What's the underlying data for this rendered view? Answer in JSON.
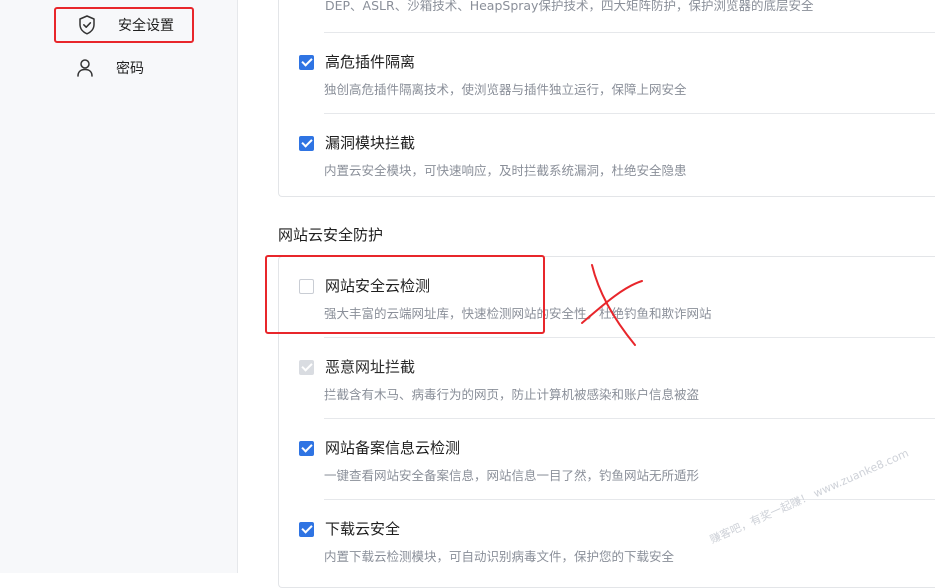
{
  "sidebar": {
    "items": [
      {
        "label": "安全设置",
        "icon": "shield-check-icon",
        "active": true
      },
      {
        "label": "密码",
        "icon": "user-icon",
        "active": false
      }
    ]
  },
  "main": {
    "top_truncated_desc": "DEP、ASLR、沙箱技术、HeapSpray保护技术，四大矩阵防护，保护浏览器的底层安全",
    "group1": [
      {
        "title": "高危插件隔离",
        "desc": "独创高危插件隔离技术，使浏览器与插件独立运行，保障上网安全",
        "checked": true
      },
      {
        "title": "漏洞模块拦截",
        "desc": "内置云安全模块，可快速响应，及时拦截系统漏洞，杜绝安全隐患",
        "checked": true
      }
    ],
    "section2_title": "网站云安全防护",
    "group2": [
      {
        "title": "网站安全云检测",
        "desc": "强大丰富的云端网址库，快速检测网站的安全性，杜绝钓鱼和欺诈网站",
        "checked": false
      },
      {
        "title": "恶意网址拦截",
        "desc": "拦截含有木马、病毒行为的网页，防止计算机被感染和账户信息被盗",
        "checked": true,
        "disabled": true
      },
      {
        "title": "网站备案信息云检测",
        "desc": "一键查看网站安全备案信息，网站信息一目了然，钓鱼网站无所遁形",
        "checked": true
      },
      {
        "title": "下载云安全",
        "desc": "内置下载云检测模块，可自动识别病毒文件，保护您的下载安全",
        "checked": true
      }
    ]
  },
  "watermark": "赚客吧，有奖一起赚！ www.zuanke8.com",
  "colors": {
    "accent": "#2f74e3",
    "annotation_red": "#e8262b"
  }
}
